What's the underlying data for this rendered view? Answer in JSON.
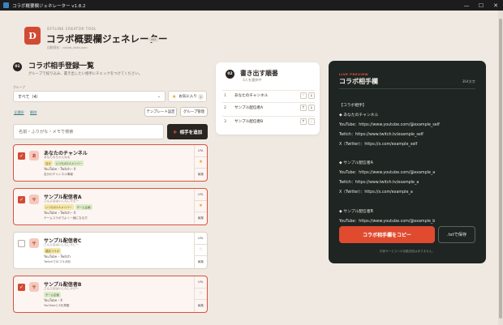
{
  "window": {
    "title": "コラボ概要欄ジェネレーター v1.8.2",
    "controls": [
      "—",
      "☐",
      "✕"
    ]
  },
  "header": {
    "logo_letter": "D",
    "subtitle": "OFFLINE CREATOR TOOL",
    "title": "コラボ概要欄ジェネレーター",
    "version_badge": "v02",
    "save_path": "自動保存：collab_data.json"
  },
  "left": {
    "section_number": "01",
    "title": "コラボ相手登録一覧",
    "description": "グループで絞り込み、書き出したい相手にチェックをつけてください。",
    "group_label": "グループ",
    "group_select": "すべて（4）",
    "favorites_button": "お気に入り",
    "favorites_count": "2",
    "select_all": "全選択",
    "clear": "解除",
    "template_button": "テンプレート設定",
    "group_manage_button": "グループ管理",
    "search_placeholder": "名前・ふりがな・メモで検索",
    "add_button": "相手を追加",
    "cards": [
      {
        "checked": true,
        "avatar": "あ",
        "name": "あなたのチャンネル",
        "kana": "あなたのちゃんねる",
        "tags": [
          "自分",
          "いつもの2人メンバー"
        ],
        "platforms": "YouTube・Twitch・X",
        "memo": "自分のチャンネル情報",
        "favorite": true,
        "side": [
          "URL",
          "★",
          "編集"
        ]
      },
      {
        "checked": true,
        "avatar": "サ",
        "name": "サンプル配信者A",
        "kana": "さんぷるはいしんしゃえー",
        "tags": [
          "いつもの2人メンバー",
          "ゲーム企画"
        ],
        "platforms": "YouTube・Twitch・X",
        "memo": "ゲームコラボでよく一緒になる方",
        "favorite": true,
        "side": [
          "URL",
          "★",
          "編集"
        ]
      },
      {
        "checked": false,
        "avatar": "サ",
        "name": "サンプル配信者C",
        "kana": "さんぷるはいしんしゃしー",
        "tags": [
          "雑談コラボ"
        ],
        "platforms": "YouTube・Twitch",
        "memo": "Twitchでのコラボ用",
        "favorite": false,
        "side": [
          "URL",
          "☆",
          "編集"
        ]
      },
      {
        "checked": true,
        "avatar": "サ",
        "name": "サンプル配信者B",
        "kana": "さんぷるはいしんしゃびー",
        "tags": [
          "ゲーム企画"
        ],
        "platforms": "YouTube・X",
        "memo": "YouTubeとXを掲載",
        "favorite": false,
        "side": [
          "URL",
          "☆",
          "編集"
        ]
      }
    ]
  },
  "order": {
    "section_number": "02",
    "title": "書き出す順番",
    "subtitle": "3人を選択中",
    "rows": [
      {
        "index": "1",
        "name": "あなたのチャンネル",
        "up": "↑",
        "down": "↓"
      },
      {
        "index": "2",
        "name": "サンプル配信者A",
        "up": "↑",
        "down": "↓"
      },
      {
        "index": "3",
        "name": "サンプル配信者B",
        "up": "↑",
        "down": "↓"
      }
    ]
  },
  "preview": {
    "label": "LIVE PREVIEW",
    "title": "コラボ相手欄",
    "char_count": "364文字",
    "text": "【コラボ相手】\n◆ あなたのチャンネル\nYouTube：https://www.youtube.com/@example_self\nTwitch：https://www.twitch.tv/example_self\nX（Twitter）：https://x.com/example_self\n\n◆ サンプル配信者A\nYouTube：https://www.youtube.com/@example_a\nTwitch：https://www.twitch.tv/example_a\nX（Twitter）：https://x.com/example_a\n\n◆ サンプル配信者B\nYouTube：https://www.youtube.com/@example_b\nX（Twitter）：https://x.com/example_b",
    "copy_button": "コラボ相手欄をコピー",
    "save_button": ".txtで保存",
    "note": "外部サービスへの自動送信はありません。"
  },
  "colors": {
    "accent": "#e04a2f",
    "dark_panel": "#1e2522",
    "background": "#efe9e2",
    "star": "#e0a526"
  }
}
